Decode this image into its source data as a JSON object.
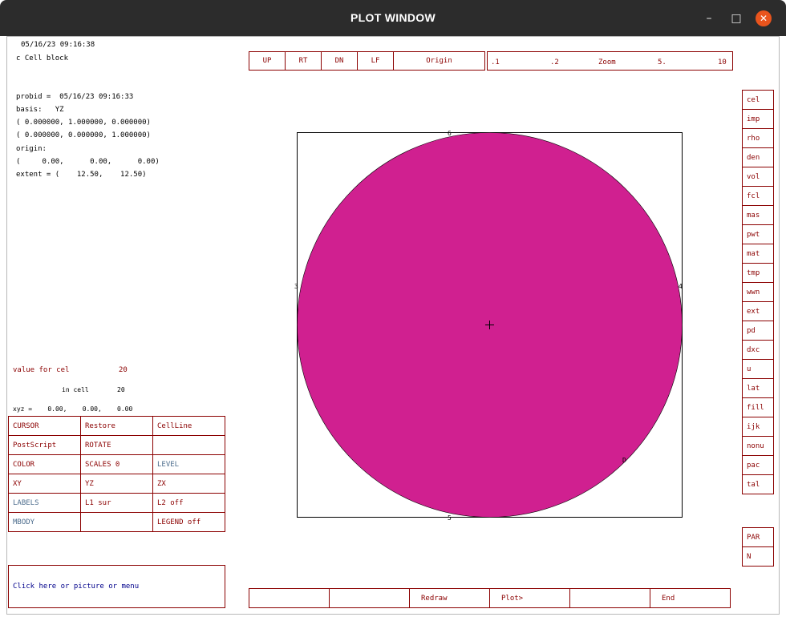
{
  "window": {
    "title": "PLOT WINDOW",
    "minimize": "–",
    "maximize": "□",
    "close": "✕"
  },
  "info": {
    "timestamp": "05/16/23 09:16:38",
    "comment": "c Cell block",
    "probid": "probid =  05/16/23 09:16:33",
    "basis": "basis:   YZ",
    "basis_row1": "( 0.000000, 1.000000, 0.000000)",
    "basis_row2": "( 0.000000, 0.000000, 1.000000)",
    "origin_label": "origin:",
    "origin_value": "(     0.00,      0.00,      0.00)",
    "extent": "extent = (    12.50,    12.50)"
  },
  "probe": {
    "value_label": "value for cel",
    "value": "20",
    "in_cell_label": "in cell",
    "in_cell": "20",
    "xyz": "xyz =    0.00,    0.00,    0.00"
  },
  "toolbar": {
    "nav": [
      "UP",
      "RT",
      "DN",
      "LF",
      "Origin"
    ],
    "zoom": [
      ".1",
      ".2",
      "Zoom",
      "5.",
      "10"
    ]
  },
  "left_menu": [
    [
      "CURSOR",
      "Restore",
      "CellLine"
    ],
    [
      "PostScript",
      "ROTATE",
      ""
    ],
    [
      "COLOR",
      "SCALES 0",
      "LEVEL"
    ],
    [
      "XY",
      "YZ",
      "ZX"
    ],
    [
      "LABELS",
      "L1 sur",
      "L2 off"
    ],
    [
      "MBODY",
      "",
      "LEGEND off"
    ]
  ],
  "right_menu": [
    "cel",
    "imp",
    "rho",
    "den",
    "vol",
    "fcl",
    "mas",
    "pwt",
    "mat",
    "tmp",
    "wwn",
    "ext",
    "pd",
    "dxc",
    "u",
    "lat",
    "fill",
    "ijk",
    "nonu",
    "pac",
    "tal"
  ],
  "right_menu_lower": [
    "PAR",
    "N"
  ],
  "prompt": "Click here or picture or menu",
  "bottom_bar": [
    "",
    "",
    "Redraw",
    "Plot>",
    "",
    "End"
  ],
  "plot": {
    "fill_color": "#d02090",
    "frame_labels": {
      "top": "6",
      "bottom": "5",
      "left": "3",
      "right": "4",
      "corner": "D"
    }
  }
}
